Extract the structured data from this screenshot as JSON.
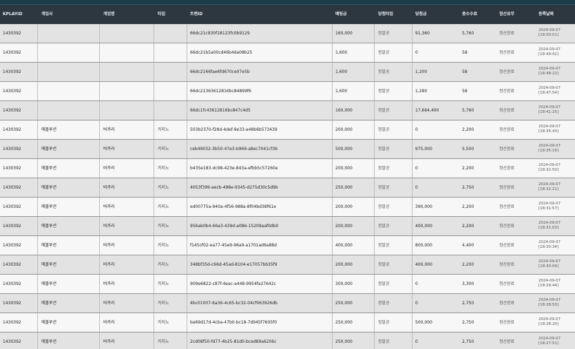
{
  "columns": [
    "KPLAYID",
    "게임사",
    "게임명",
    "타입",
    "트랜ID",
    "배팅금",
    "당첨타입",
    "당첨금",
    "총수수료",
    "정산유무",
    "등록날짜"
  ],
  "rows": [
    {
      "kplayid": "1430392",
      "vendor": "",
      "game": "",
      "type": "",
      "tid": "66dc21c930f18123fc0b9129",
      "bet": "160,000",
      "win_type": "정말공",
      "win": "91,360",
      "fee": "5,760",
      "settle": "정산완료",
      "date1": "2024-09-07",
      "date2": "[18:50:01]"
    },
    {
      "kplayid": "1430392",
      "vendor": "",
      "game": "",
      "type": "",
      "tid": "66dc21b5a00cd46b4da08b25",
      "bet": "1,600",
      "win_type": "정말공",
      "win": "0",
      "fee": "58",
      "settle": "정산완료",
      "date1": "2024-09-07",
      "date2": "[18:49:42]"
    },
    {
      "kplayid": "1430392",
      "vendor": "",
      "game": "",
      "type": "",
      "tid": "66dc2166fae6fd670ce07e5b",
      "bet": "1,600",
      "win_type": "정말공",
      "win": "1,200",
      "fee": "58",
      "settle": "정산완료",
      "date1": "2024-09-07",
      "date2": "[18:48:22]"
    },
    {
      "kplayid": "1430392",
      "vendor": "",
      "game": "",
      "type": "",
      "tid": "66dc21363612816bc84899f6",
      "bet": "1,600",
      "win_type": "정말공",
      "win": "1,280",
      "fee": "58",
      "settle": "정산완료",
      "date1": "2024-09-07",
      "date2": "[18:47:54]"
    },
    {
      "kplayid": "1430392",
      "vendor": "",
      "game": "",
      "type": "",
      "tid": "66dc1fc43612816bc847c4d5",
      "bet": "160,000",
      "win_type": "정말공",
      "win": "17,664,400",
      "fee": "5,760",
      "settle": "정산완료",
      "date1": "2024-09-07",
      "date2": "[18:41:25]"
    },
    {
      "kplayid": "1430392",
      "vendor": "에볼루션",
      "game": "바카라",
      "type": "카지노",
      "tid": "503b2370-f28d-4def-9e33-a48b6b573439",
      "bet": "200,000",
      "win_type": "정말공",
      "win": "0",
      "fee": "2,200",
      "settle": "정산완료",
      "date1": "2024-09-07",
      "date2": "[18:35:43]"
    },
    {
      "kplayid": "1430392",
      "vendor": "에볼루션",
      "game": "바카라",
      "type": "카지노",
      "tid": "ceb49032-3b50-47e3-b969-a8ec7041cf3b",
      "bet": "500,000",
      "win_type": "정말공",
      "win": "975,000",
      "fee": "5,500",
      "settle": "정산완료",
      "date1": "2024-09-07",
      "date2": "[18:35:16]"
    },
    {
      "kplayid": "1430392",
      "vendor": "에볼루션",
      "game": "바카라",
      "type": "카지노",
      "tid": "b435e183-dc98-423e-843a-efbb5c57260e",
      "bet": "200,000",
      "win_type": "정말공",
      "win": "0",
      "fee": "2,200",
      "settle": "정산완료",
      "date1": "2024-09-07",
      "date2": "[18:32:50]"
    },
    {
      "kplayid": "1430392",
      "vendor": "에볼루션",
      "game": "바카라",
      "type": "카지노",
      "tid": "4053f399-aecb-498e-9345-d275d30c5d9b",
      "bet": "250,000",
      "win_type": "정말공",
      "win": "0",
      "fee": "2,750",
      "settle": "정산완료",
      "date1": "2024-09-07",
      "date2": "[18:32:21]"
    },
    {
      "kplayid": "1430392",
      "vendor": "에볼루션",
      "game": "바카라",
      "type": "카지노",
      "tid": "ed00775a-940a-4f56-988a-8f04bd38f61e",
      "bet": "200,000",
      "win_type": "정말공",
      "win": "390,000",
      "fee": "2,200",
      "settle": "정산완료",
      "date1": "2024-09-07",
      "date2": "[18:31:57]"
    },
    {
      "kplayid": "1430392",
      "vendor": "에볼루션",
      "game": "바카라",
      "type": "카지노",
      "tid": "956ab0b4-66a3-439d-a086-15209aaf0db0",
      "bet": "200,000",
      "win_type": "정말공",
      "win": "400,000",
      "fee": "2,200",
      "settle": "정산완료",
      "date1": "2024-09-07",
      "date2": "[18:31:03]"
    },
    {
      "kplayid": "1430392",
      "vendor": "에볼루션",
      "game": "바카라",
      "type": "카지노",
      "tid": "f145cf02-ea77-45e9-96a9-a1701ad6a88d",
      "bet": "400,000",
      "win_type": "정말공",
      "win": "800,000",
      "fee": "4,400",
      "settle": "정산완료",
      "date1": "2024-09-07",
      "date2": "[18:30:34]"
    },
    {
      "kplayid": "1430392",
      "vendor": "에볼루션",
      "game": "바카라",
      "type": "카지노",
      "tid": "348bf35d-c66d-45ad-8104-e17057bb35f9",
      "bet": "200,000",
      "win_type": "정말공",
      "win": "400,000",
      "fee": "2,200",
      "settle": "정산완료",
      "date1": "2024-09-07",
      "date2": "[18:30:09]"
    },
    {
      "kplayid": "1430392",
      "vendor": "에볼루션",
      "game": "바카라",
      "type": "카지노",
      "tid": "909e6822-c87f-4eac-a448-9954fa27642c",
      "bet": "300,000",
      "win_type": "정말공",
      "win": "0",
      "fee": "3,300",
      "settle": "정산완료",
      "date1": "2024-09-07",
      "date2": "[18:29:44]"
    },
    {
      "kplayid": "1430392",
      "vendor": "에볼루션",
      "game": "바카라",
      "type": "카지노",
      "tid": "4bc01007-6a36-4c65-bc32-04cf063926db",
      "bet": "250,000",
      "win_type": "정말공",
      "win": "0",
      "fee": "2,750",
      "settle": "정산완료",
      "date1": "2024-09-07",
      "date2": "[18:28:50]"
    },
    {
      "kplayid": "1430392",
      "vendor": "에볼루션",
      "game": "바카라",
      "type": "카지노",
      "tid": "ba69d17d-4cba-47b0-bc18-7d945f7605f0",
      "bet": "250,000",
      "win_type": "정말공",
      "win": "500,000",
      "fee": "2,750",
      "settle": "정산완료",
      "date1": "2024-09-07",
      "date2": "[18:28:20]"
    },
    {
      "kplayid": "1430392",
      "vendor": "에볼루션",
      "game": "바카라",
      "type": "카지노",
      "tid": "2cd08f50-fd77-4b25-81d0-bced89a6206c",
      "bet": "250,000",
      "win_type": "정말공",
      "win": "0",
      "fee": "2,750",
      "settle": "정산완료",
      "date1": "2024-09-07",
      "date2": "[18:27:51]"
    }
  ]
}
